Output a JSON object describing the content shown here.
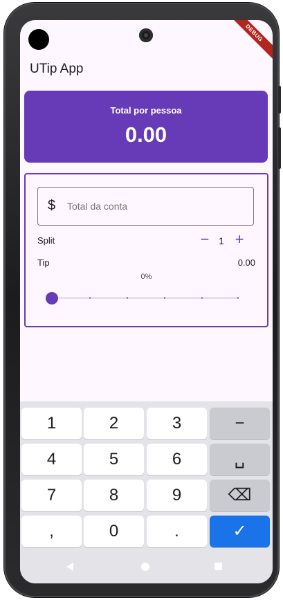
{
  "app": {
    "title": "UTip App",
    "debug_banner": "DEBUG"
  },
  "total_card": {
    "label": "Total por pessoa",
    "value": "0.00"
  },
  "bill": {
    "icon": "attach-money-icon",
    "placeholder": "Total da conta",
    "value": ""
  },
  "split": {
    "label": "Split",
    "minus": "−",
    "value": "1",
    "plus": "+"
  },
  "tip": {
    "label": "Tip",
    "amount": "0.00",
    "percent_label": "0%",
    "slider_value": 0
  },
  "keyboard": {
    "rows": [
      [
        "1",
        "2",
        "3",
        "−"
      ],
      [
        "4",
        "5",
        "6",
        "␣"
      ],
      [
        "7",
        "8",
        "9",
        "⌫"
      ],
      [
        ",",
        "0",
        ".",
        "✓"
      ]
    ]
  },
  "colors": {
    "primary": "#673ab7",
    "background": "#fef7ff",
    "keyboard_bg": "#e3e3e8",
    "done_key": "#1a73e8",
    "debug": "#b3261e"
  }
}
